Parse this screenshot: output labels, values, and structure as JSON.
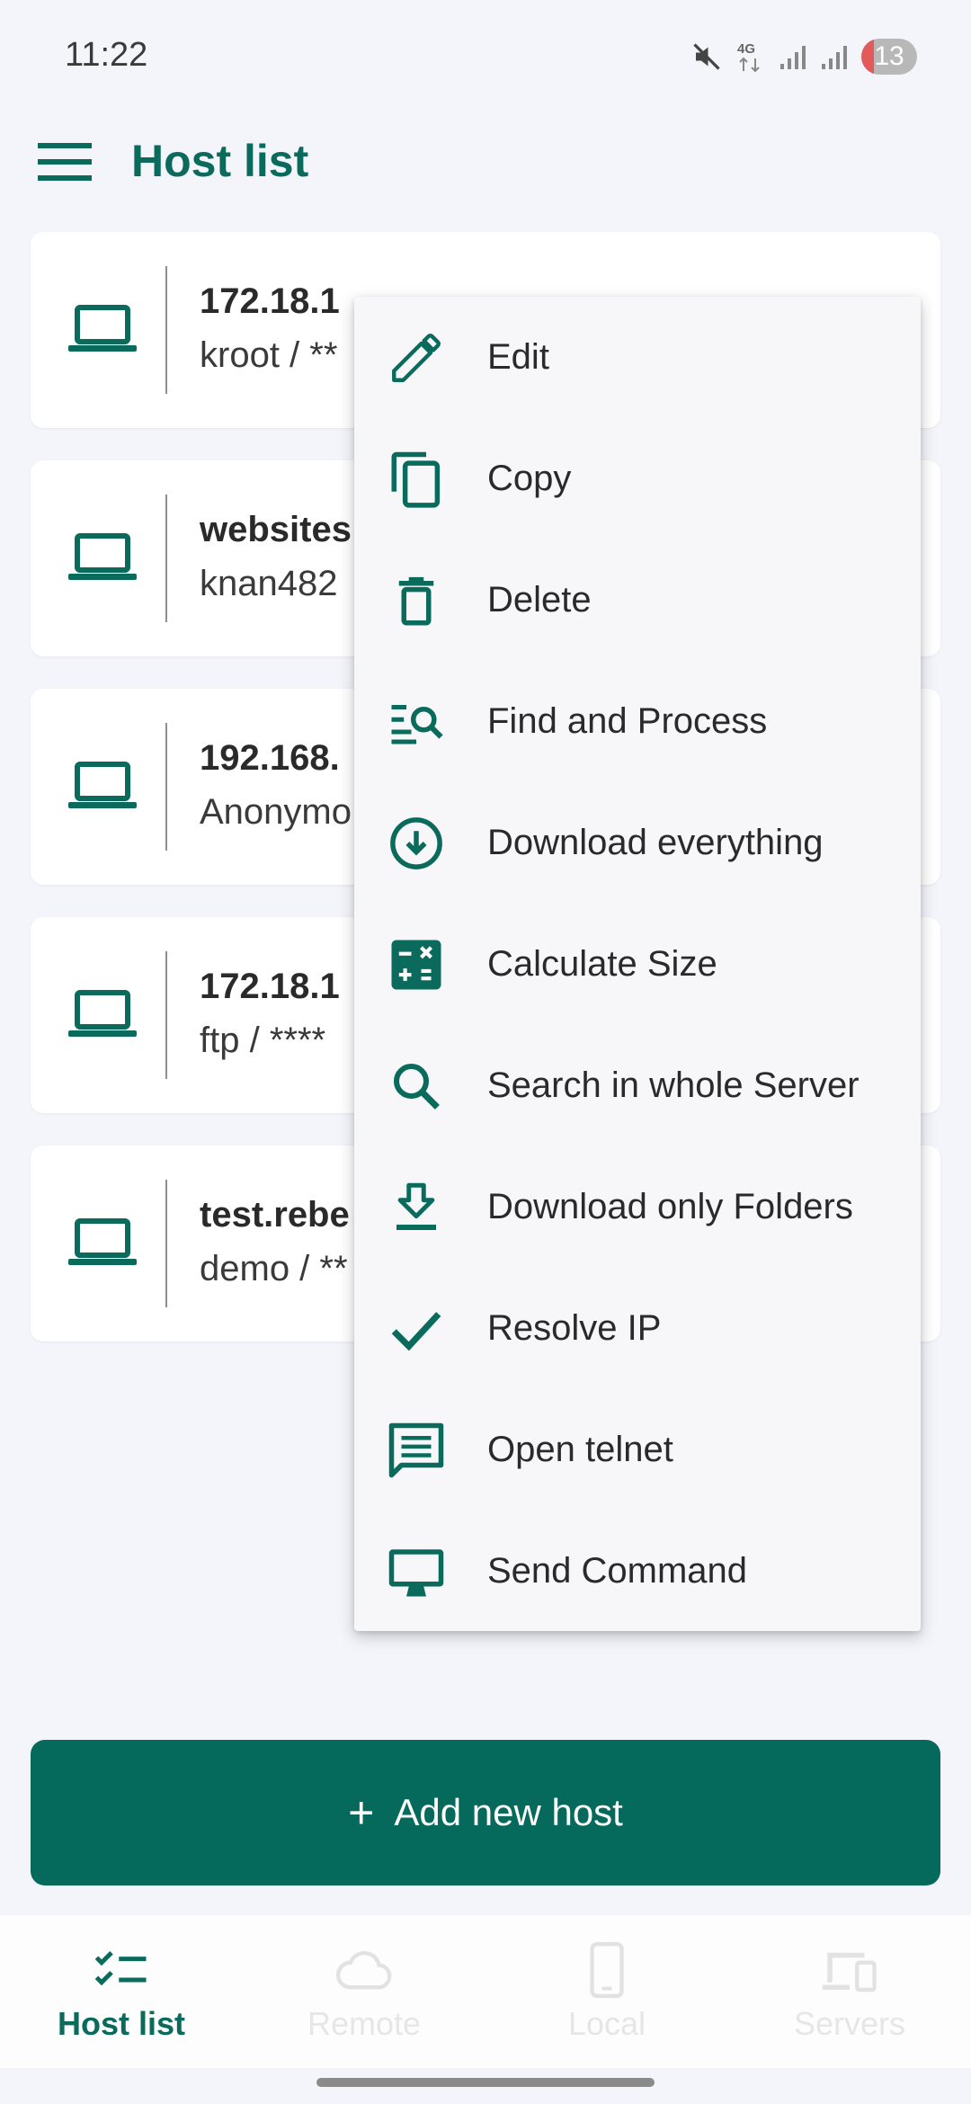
{
  "status_bar": {
    "time": "11:22",
    "network": "4G",
    "battery": "13",
    "icons": [
      "mute-icon",
      "network-4g-icon",
      "signal-icon",
      "signal-icon",
      "battery-icon"
    ]
  },
  "app_bar": {
    "title": "Host list",
    "menu_icon": "hamburger-menu-icon"
  },
  "hosts": [
    {
      "name": "172.18.1",
      "user": "kroot / **"
    },
    {
      "name": "websites",
      "user": "knan482"
    },
    {
      "name": "192.168.",
      "user": "Anonymo"
    },
    {
      "name": "172.18.1",
      "user": "ftp / ****"
    },
    {
      "name": "test.rebe",
      "user": "demo / **"
    }
  ],
  "context_menu": {
    "items": [
      {
        "label": "Edit",
        "icon": "pencil-icon"
      },
      {
        "label": "Copy",
        "icon": "copy-icon"
      },
      {
        "label": "Delete",
        "icon": "trash-icon"
      },
      {
        "label": "Find and Process",
        "icon": "find-list-icon"
      },
      {
        "label": "Download everything",
        "icon": "download-circle-icon"
      },
      {
        "label": "Calculate Size",
        "icon": "calculator-icon"
      },
      {
        "label": "Search in whole Server",
        "icon": "search-icon"
      },
      {
        "label": "Download only Folders",
        "icon": "download-tray-icon"
      },
      {
        "label": "Resolve IP",
        "icon": "check-icon"
      },
      {
        "label": "Open telnet",
        "icon": "message-icon"
      },
      {
        "label": "Send Command",
        "icon": "monitor-icon"
      }
    ]
  },
  "add_button": {
    "plus": "+",
    "label": "Add new host"
  },
  "bottom_nav": {
    "items": [
      {
        "label": "Host list",
        "icon": "checklist-icon",
        "active": true
      },
      {
        "label": "Remote",
        "icon": "cloud-icon",
        "active": false
      },
      {
        "label": "Local",
        "icon": "phone-icon",
        "active": false
      },
      {
        "label": "Servers",
        "icon": "devices-icon",
        "active": false
      }
    ]
  },
  "colors": {
    "accent": "#0a6b5c",
    "button": "#05695b",
    "background": "#f4f5fb",
    "card": "#ffffff",
    "menu": "#f7f7fa"
  }
}
